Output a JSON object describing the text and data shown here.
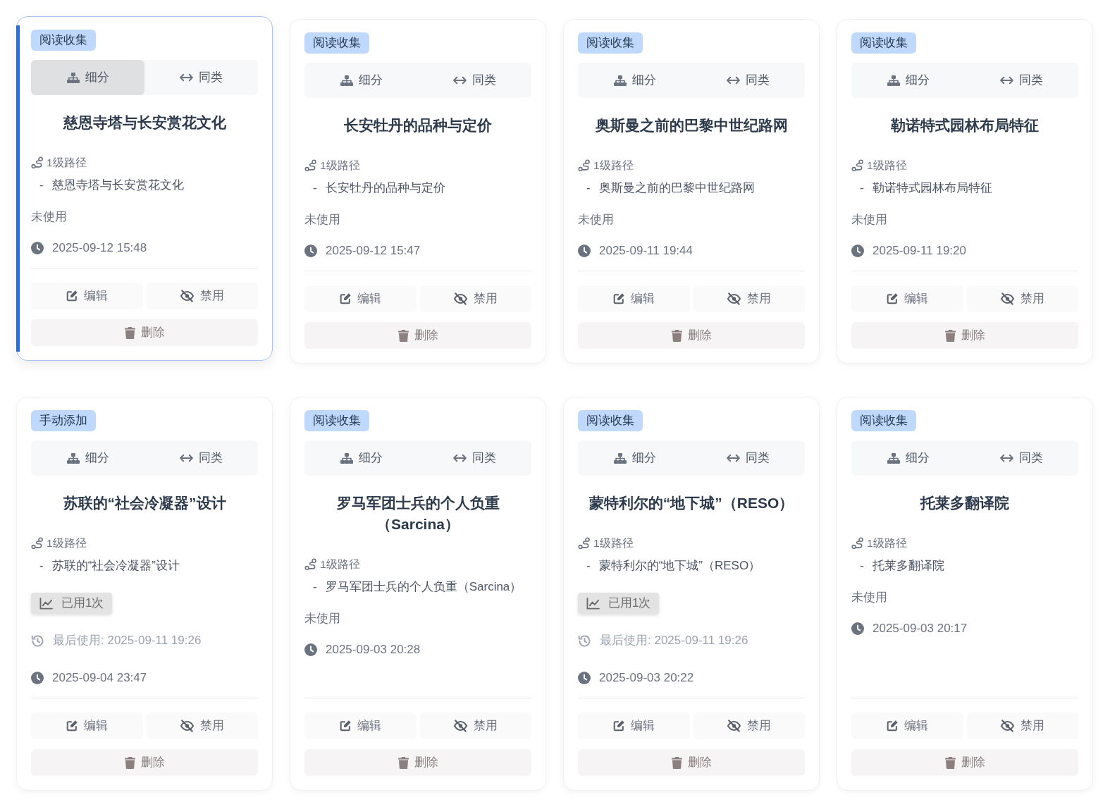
{
  "cards": [
    {
      "selected": true,
      "tag": "阅读收集",
      "view_tabs": [
        {
          "kind": "breakdown",
          "label": "细分",
          "selected": true
        },
        {
          "kind": "similar",
          "label": "同类",
          "selected": false
        }
      ],
      "title": "慈恩寺塔与长安赏花文化",
      "path": {
        "label": "1级路径",
        "items": [
          {
            "marker": "-",
            "text": "慈恩寺塔与长安赏花文化"
          }
        ]
      },
      "usage": {
        "kind": "unused",
        "text": "未使用"
      },
      "created": "2025-09-12 15:48",
      "actions": [
        {
          "kind": "edit",
          "label": "编辑"
        },
        {
          "kind": "disable",
          "label": "禁用"
        },
        {
          "kind": "delete",
          "label": "删除"
        }
      ]
    },
    {
      "selected": false,
      "tag": "阅读收集",
      "view_tabs": [
        {
          "kind": "breakdown",
          "label": "细分",
          "selected": false
        },
        {
          "kind": "similar",
          "label": "同类",
          "selected": false
        }
      ],
      "title": "长安牡丹的品种与定价",
      "path": {
        "label": "1级路径",
        "items": [
          {
            "marker": "-",
            "text": "长安牡丹的品种与定价"
          }
        ]
      },
      "usage": {
        "kind": "unused",
        "text": "未使用"
      },
      "created": "2025-09-12 15:47",
      "actions": [
        {
          "kind": "edit",
          "label": "编辑"
        },
        {
          "kind": "disable",
          "label": "禁用"
        },
        {
          "kind": "delete",
          "label": "删除"
        }
      ]
    },
    {
      "selected": false,
      "tag": "阅读收集",
      "view_tabs": [
        {
          "kind": "breakdown",
          "label": "细分",
          "selected": false
        },
        {
          "kind": "similar",
          "label": "同类",
          "selected": false
        }
      ],
      "title": "奥斯曼之前的巴黎中世纪路网",
      "path": {
        "label": "1级路径",
        "items": [
          {
            "marker": "-",
            "text": "奥斯曼之前的巴黎中世纪路网"
          }
        ]
      },
      "usage": {
        "kind": "unused",
        "text": "未使用"
      },
      "created": "2025-09-11 19:44",
      "actions": [
        {
          "kind": "edit",
          "label": "编辑"
        },
        {
          "kind": "disable",
          "label": "禁用"
        },
        {
          "kind": "delete",
          "label": "删除"
        }
      ]
    },
    {
      "selected": false,
      "tag": "阅读收集",
      "view_tabs": [
        {
          "kind": "breakdown",
          "label": "细分",
          "selected": false
        },
        {
          "kind": "similar",
          "label": "同类",
          "selected": false
        }
      ],
      "title": "勒诺特式园林布局特征",
      "path": {
        "label": "1级路径",
        "items": [
          {
            "marker": "-",
            "text": "勒诺特式园林布局特征"
          }
        ]
      },
      "usage": {
        "kind": "unused",
        "text": "未使用"
      },
      "created": "2025-09-11 19:20",
      "actions": [
        {
          "kind": "edit",
          "label": "编辑"
        },
        {
          "kind": "disable",
          "label": "禁用"
        },
        {
          "kind": "delete",
          "label": "删除"
        }
      ]
    },
    {
      "selected": false,
      "tag": "手动添加",
      "view_tabs": [
        {
          "kind": "breakdown",
          "label": "细分",
          "selected": false
        },
        {
          "kind": "similar",
          "label": "同类",
          "selected": false
        }
      ],
      "title": "苏联的“社会冷凝器”设计",
      "path": {
        "label": "1级路径",
        "items": [
          {
            "marker": "-",
            "text": "苏联的“社会冷凝器”设计"
          }
        ]
      },
      "usage": {
        "kind": "used",
        "count": "已用1次",
        "last_used": "最后使用: 2025-09-11 19:26"
      },
      "created": "2025-09-04 23:47",
      "actions": [
        {
          "kind": "edit",
          "label": "编辑"
        },
        {
          "kind": "disable",
          "label": "禁用"
        },
        {
          "kind": "delete",
          "label": "删除"
        }
      ]
    },
    {
      "selected": false,
      "tag": "阅读收集",
      "view_tabs": [
        {
          "kind": "breakdown",
          "label": "细分",
          "selected": false
        },
        {
          "kind": "similar",
          "label": "同类",
          "selected": false
        }
      ],
      "title": "罗马军团士兵的个人负重（Sarcina）",
      "path": {
        "label": "1级路径",
        "items": [
          {
            "marker": "-",
            "text": "罗马军团士兵的个人负重（Sarcina）"
          }
        ]
      },
      "usage": {
        "kind": "unused",
        "text": "未使用"
      },
      "created": "2025-09-03 20:28",
      "actions": [
        {
          "kind": "edit",
          "label": "编辑"
        },
        {
          "kind": "disable",
          "label": "禁用"
        },
        {
          "kind": "delete",
          "label": "删除"
        }
      ]
    },
    {
      "selected": false,
      "tag": "阅读收集",
      "view_tabs": [
        {
          "kind": "breakdown",
          "label": "细分",
          "selected": false
        },
        {
          "kind": "similar",
          "label": "同类",
          "selected": false
        }
      ],
      "title": "蒙特利尔的“地下城”（RESO）",
      "path": {
        "label": "1级路径",
        "items": [
          {
            "marker": "-",
            "text": "蒙特利尔的“地下城”（RESO）"
          }
        ]
      },
      "usage": {
        "kind": "used",
        "count": "已用1次",
        "last_used": "最后使用: 2025-09-11 19:26"
      },
      "created": "2025-09-03 20:22",
      "actions": [
        {
          "kind": "edit",
          "label": "编辑"
        },
        {
          "kind": "disable",
          "label": "禁用"
        },
        {
          "kind": "delete",
          "label": "删除"
        }
      ]
    },
    {
      "selected": false,
      "tag": "阅读收集",
      "view_tabs": [
        {
          "kind": "breakdown",
          "label": "细分",
          "selected": false
        },
        {
          "kind": "similar",
          "label": "同类",
          "selected": false
        }
      ],
      "title": "托莱多翻译院",
      "path": {
        "label": "1级路径",
        "items": [
          {
            "marker": "-",
            "text": "托莱多翻译院"
          }
        ]
      },
      "usage": {
        "kind": "unused",
        "text": "未使用"
      },
      "created": "2025-09-03 20:17",
      "actions": [
        {
          "kind": "edit",
          "label": "编辑"
        },
        {
          "kind": "disable",
          "label": "禁用"
        },
        {
          "kind": "delete",
          "label": "删除"
        }
      ]
    }
  ]
}
